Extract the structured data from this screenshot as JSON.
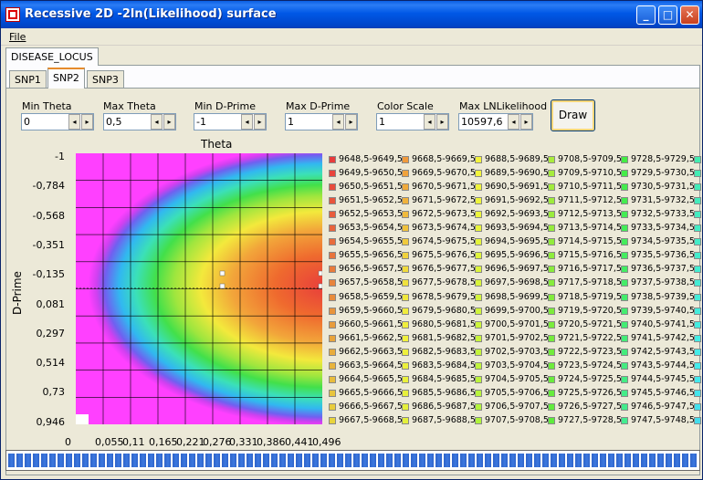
{
  "window": {
    "title": "Recessive 2D -2ln(Likelihood) surface",
    "buttons": [
      "_",
      "□",
      "✕"
    ]
  },
  "menu": {
    "file": "File"
  },
  "outer_tabs": [
    "DISEASE_LOCUS"
  ],
  "inner_tabs": [
    "SNP1",
    "SNP2",
    "SNP3"
  ],
  "selected_inner_tab": "SNP2",
  "controls": [
    {
      "label": "Min Theta",
      "value": "0"
    },
    {
      "label": "Max Theta",
      "value": "0,5"
    },
    {
      "label": "Min D-Prime",
      "value": "-1"
    },
    {
      "label": "Max D-Prime",
      "value": "1"
    },
    {
      "label": "Color Scale",
      "value": "1"
    },
    {
      "label": "Max LNLikelihood",
      "value": "10597,6"
    }
  ],
  "spin_arrows": {
    "left": "◂",
    "right": "▸"
  },
  "draw_button": "Draw",
  "plot": {
    "xlabel": "Theta",
    "ylabel": "D-Prime",
    "yticks": [
      "-1",
      "-0,784",
      "-0,568",
      "-0,351",
      "-0,135",
      "0,081",
      "0,297",
      "0,514",
      "0,73",
      "0,946"
    ],
    "xticks": [
      "0",
      "0,055",
      "0,11",
      "0,165",
      "0,221",
      "0,276",
      "0,331",
      "0,386",
      "0,441",
      "0,496"
    ]
  },
  "legend": {
    "columns": [
      {
        "color": "#e84040",
        "items": [
          "9648,5-9649,5",
          "9649,5-9650,5",
          "9650,5-9651,5",
          "9651,5-9652,5",
          "9652,5-9653,5",
          "9653,5-9654,5",
          "9654,5-9655,5",
          "9655,5-9656,5",
          "9656,5-9657,5",
          "9657,5-9658,5",
          "9658,5-9659,5",
          "9659,5-9660,5",
          "9660,5-9661,5",
          "9661,5-9662,5",
          "9662,5-9663,5",
          "9663,5-9664,5",
          "9664,5-9665,5",
          "9665,5-9666,5",
          "9666,5-9667,5",
          "9667,5-9668,5"
        ],
        "swatches": [
          "#e83c3c",
          "#e8443c",
          "#e84c3c",
          "#e8543c",
          "#e85c3c",
          "#e8643c",
          "#e86c3c",
          "#e8743c",
          "#e87c3c",
          "#e8843c",
          "#e88c3c",
          "#e8943c",
          "#e89c3c",
          "#e8a43c",
          "#e8ac3c",
          "#e8b43c",
          "#e8bc3c",
          "#e8c43c",
          "#e8cc3c",
          "#e8d43c"
        ]
      },
      {
        "color": "#f0a040",
        "items": [
          "9668,5-9669,5",
          "9669,5-9670,5",
          "9670,5-9671,5",
          "9671,5-9672,5",
          "9672,5-9673,5",
          "9673,5-9674,5",
          "9674,5-9675,5",
          "9675,5-9676,5",
          "9676,5-9677,5",
          "9677,5-9678,5",
          "9678,5-9679,5",
          "9679,5-9680,5",
          "9680,5-9681,5",
          "9681,5-9682,5",
          "9682,5-9683,5",
          "9683,5-9684,5",
          "9684,5-9685,5",
          "9685,5-9686,5",
          "9686,5-9687,5",
          "9687,5-9688,5"
        ],
        "swatches": [
          "#f09a3c",
          "#f0a23c",
          "#f0aa3c",
          "#f0b23c",
          "#f0ba3c",
          "#f0c23c",
          "#f0ca3c",
          "#f0d23c",
          "#f0da3c",
          "#f0e23c",
          "#f0e83c",
          "#f0ec3c",
          "#f0ee3c",
          "#f0f03c",
          "#eef03c",
          "#ecf03c",
          "#eaf03c",
          "#e8f03c",
          "#e6f03c",
          "#e4f03c"
        ]
      },
      {
        "color": "#f0f040",
        "items": [
          "9688,5-9689,5",
          "9689,5-9690,5",
          "9690,5-9691,5",
          "9691,5-9692,5",
          "9692,5-9693,5",
          "9693,5-9694,5",
          "9694,5-9695,5",
          "9695,5-9696,5",
          "9696,5-9697,5",
          "9697,5-9698,5",
          "9698,5-9699,5",
          "9699,5-9700,5",
          "9700,5-9701,5",
          "9701,5-9702,5",
          "9702,5-9703,5",
          "9703,5-9704,5",
          "9704,5-9705,5",
          "9705,5-9706,5",
          "9706,5-9707,5",
          "9707,5-9708,5"
        ],
        "swatches": [
          "#f4f43c",
          "#f2f43c",
          "#f0f43c",
          "#eef43c",
          "#ecf43c",
          "#e8f43c",
          "#e4f43c",
          "#e0f43c",
          "#dcf43c",
          "#d8f43c",
          "#d4f43c",
          "#d0f43c",
          "#ccf43c",
          "#c8f43c",
          "#c4f43c",
          "#c0f43c",
          "#bcf43c",
          "#b8f43c",
          "#b4f43c",
          "#b0f43c"
        ]
      },
      {
        "color": "#a0e840",
        "items": [
          "9708,5-9709,5",
          "9709,5-9710,5",
          "9710,5-9711,5",
          "9711,5-9712,5",
          "9712,5-9713,5",
          "9713,5-9714,5",
          "9714,5-9715,5",
          "9715,5-9716,5",
          "9716,5-9717,5",
          "9717,5-9718,5",
          "9718,5-9719,5",
          "9719,5-9720,5",
          "9720,5-9721,5",
          "9721,5-9722,5",
          "9722,5-9723,5",
          "9723,5-9724,5",
          "9724,5-9725,5",
          "9725,5-9726,5",
          "9726,5-9727,5",
          "9727,5-9728,5"
        ],
        "swatches": [
          "#aaec3c",
          "#a6ec3c",
          "#a2ec3c",
          "#9eec3c",
          "#9aec3c",
          "#96ec3c",
          "#92ec3c",
          "#8eec3c",
          "#8aec3c",
          "#86ec3c",
          "#82ec3c",
          "#7eec3c",
          "#7aec3c",
          "#76ec3c",
          "#72ec3c",
          "#6eec3c",
          "#6aec3c",
          "#66ec3c",
          "#62ec3c",
          "#5eec3c"
        ]
      },
      {
        "color": "#40e060",
        "items": [
          "9728,5-9729,5",
          "9729,5-9730,5",
          "9730,5-9731,5",
          "9731,5-9732,5",
          "9732,5-9733,5",
          "9733,5-9734,5",
          "9734,5-9735,5",
          "9735,5-9736,5",
          "9736,5-9737,5",
          "9737,5-9738,5",
          "9738,5-9739,5",
          "9739,5-9740,5",
          "9740,5-9741,5",
          "9741,5-9742,5",
          "9742,5-9743,5",
          "9743,5-9744,5",
          "9744,5-9745,5",
          "9745,5-9746,5",
          "9746,5-9747,5",
          "9747,5-9748,5"
        ],
        "swatches": [
          "#44ec44",
          "#44ec48",
          "#44ec4c",
          "#44ec50",
          "#44ec54",
          "#44ec58",
          "#44ec5c",
          "#44ec60",
          "#44ec64",
          "#44ec68",
          "#44ec6c",
          "#44ec70",
          "#44ec74",
          "#44ec78",
          "#44ec7c",
          "#44ec80",
          "#44ec84",
          "#44ec88",
          "#44ec8c",
          "#44ec90"
        ]
      },
      {
        "color": "#40e0a0",
        "items": [],
        "swatches": [
          "#44ecb0",
          "#44ecb4",
          "#44ecb8",
          "#44ecbc",
          "#44ecc0",
          "#44ecc4",
          "#44ecc8",
          "#44eccc",
          "#44ecd0",
          "#44ecd4",
          "#44ecd8",
          "#44ecdc",
          "#44ece0",
          "#44ece4",
          "#44ece8",
          "#44ecec",
          "#44e8ec",
          "#44e4ec",
          "#44e0ec",
          "#44dcec"
        ]
      }
    ]
  },
  "colors": {
    "background_fill": "#ff40ff",
    "title_bar": "#0058e6"
  },
  "progress": {
    "fraction": 1.0
  }
}
